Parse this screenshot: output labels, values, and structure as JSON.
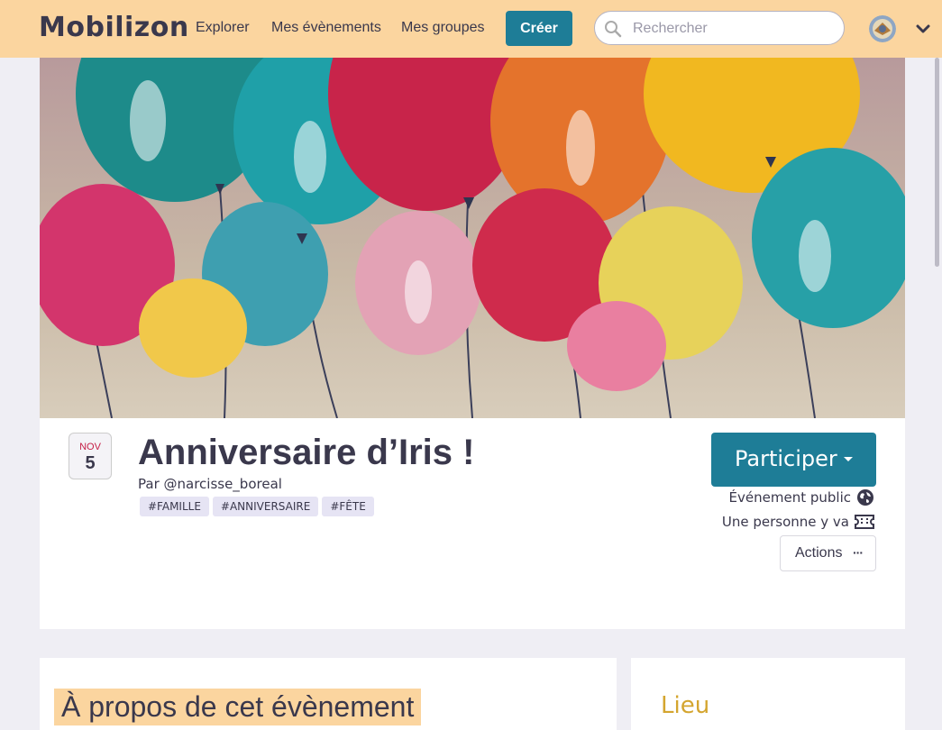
{
  "navbar": {
    "logo": "Mobilizon",
    "links": [
      "Explorer",
      "Mes évènements",
      "Mes groupes"
    ],
    "create_label": "Créer",
    "search_placeholder": "Rechercher"
  },
  "event": {
    "date_month": "NOV",
    "date_day": "5",
    "title": "Anniversaire d’Iris !",
    "organizer": "Par @narcisse_boreal",
    "tags": [
      "#FAMILLE",
      "#ANNIVERSAIRE",
      "#FÊTE"
    ],
    "participate_label": "Participer",
    "visibility": "Événement public",
    "attendance": "Une personne y va",
    "actions_label": "Actions"
  },
  "sections": {
    "about_title": "À propos de cet évènement",
    "place_title": "Lieu"
  },
  "colors": {
    "navbar_bg": "#fbd59f",
    "primary": "#1e7d97",
    "date_month": "#c51f47",
    "place_title": "#d4a52f"
  }
}
